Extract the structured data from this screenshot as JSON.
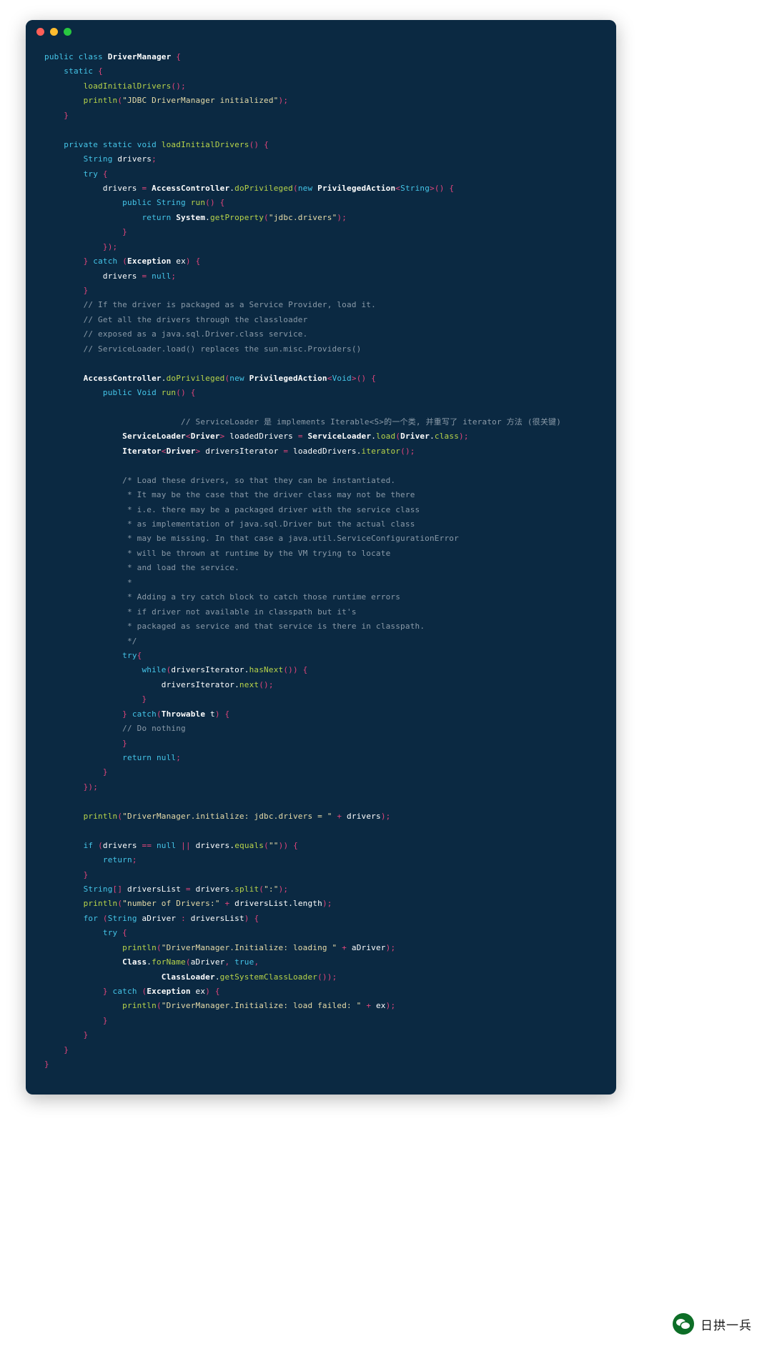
{
  "window": {
    "traffic_lights": [
      {
        "name": "close",
        "color": "#ff5f57"
      },
      {
        "name": "minimize",
        "color": "#febc2e"
      },
      {
        "name": "maximize",
        "color": "#28c840"
      }
    ],
    "background": "#0b2942"
  },
  "watermark": {
    "label": "日拱一兵",
    "icon": "wechat-icon"
  },
  "theme": {
    "background": "#0b2942",
    "foreground": "#ffffff",
    "keyword": "#45c5e8",
    "function": "#b8d44a",
    "punctuation": "#e0457b",
    "string": "#e6dba8",
    "comment": "#8a9aa8"
  },
  "code": {
    "language": "java",
    "class_name": "DriverManager",
    "lines": [
      "public class DriverManager {",
      "    static {",
      "        loadInitialDrivers();",
      "        println(\"JDBC DriverManager initialized\");",
      "    }",
      "",
      "    private static void loadInitialDrivers() {",
      "        String drivers;",
      "        try {",
      "            drivers = AccessController.doPrivileged(new PrivilegedAction<String>() {",
      "                public String run() {",
      "                    return System.getProperty(\"jdbc.drivers\");",
      "                }",
      "            });",
      "        } catch (Exception ex) {",
      "            drivers = null;",
      "        }",
      "        // If the driver is packaged as a Service Provider, load it.",
      "        // Get all the drivers through the classloader",
      "        // exposed as a java.sql.Driver.class service.",
      "        // ServiceLoader.load() replaces the sun.misc.Providers()",
      "",
      "        AccessController.doPrivileged(new PrivilegedAction<Void>() {",
      "            public Void run() {",
      "",
      "                            // ServiceLoader 是 implements Iterable<S>的一个类, 并重写了 iterator 方法 (很关键)",
      "                ServiceLoader<Driver> loadedDrivers = ServiceLoader.load(Driver.class);",
      "                Iterator<Driver> driversIterator = loadedDrivers.iterator();",
      "",
      "                /* Load these drivers, so that they can be instantiated.",
      "                 * It may be the case that the driver class may not be there",
      "                 * i.e. there may be a packaged driver with the service class",
      "                 * as implementation of java.sql.Driver but the actual class",
      "                 * may be missing. In that case a java.util.ServiceConfigurationError",
      "                 * will be thrown at runtime by the VM trying to locate",
      "                 * and load the service.",
      "                 *",
      "                 * Adding a try catch block to catch those runtime errors",
      "                 * if driver not available in classpath but it's",
      "                 * packaged as service and that service is there in classpath.",
      "                 */",
      "                try{",
      "                    while(driversIterator.hasNext()) {",
      "                        driversIterator.next();",
      "                    }",
      "                } catch(Throwable t) {",
      "                // Do nothing",
      "                }",
      "                return null;",
      "            }",
      "        });",
      "",
      "        println(\"DriverManager.initialize: jdbc.drivers = \" + drivers);",
      "",
      "        if (drivers == null || drivers.equals(\"\")) {",
      "            return;",
      "        }",
      "        String[] driversList = drivers.split(\":\");",
      "        println(\"number of Drivers:\" + driversList.length);",
      "        for (String aDriver : driversList) {",
      "            try {",
      "                println(\"DriverManager.Initialize: loading \" + aDriver);",
      "                Class.forName(aDriver, true,",
      "                        ClassLoader.getSystemClassLoader());",
      "            } catch (Exception ex) {",
      "                println(\"DriverManager.Initialize: load failed: \" + ex);",
      "            }",
      "        }",
      "    }",
      "}"
    ]
  }
}
